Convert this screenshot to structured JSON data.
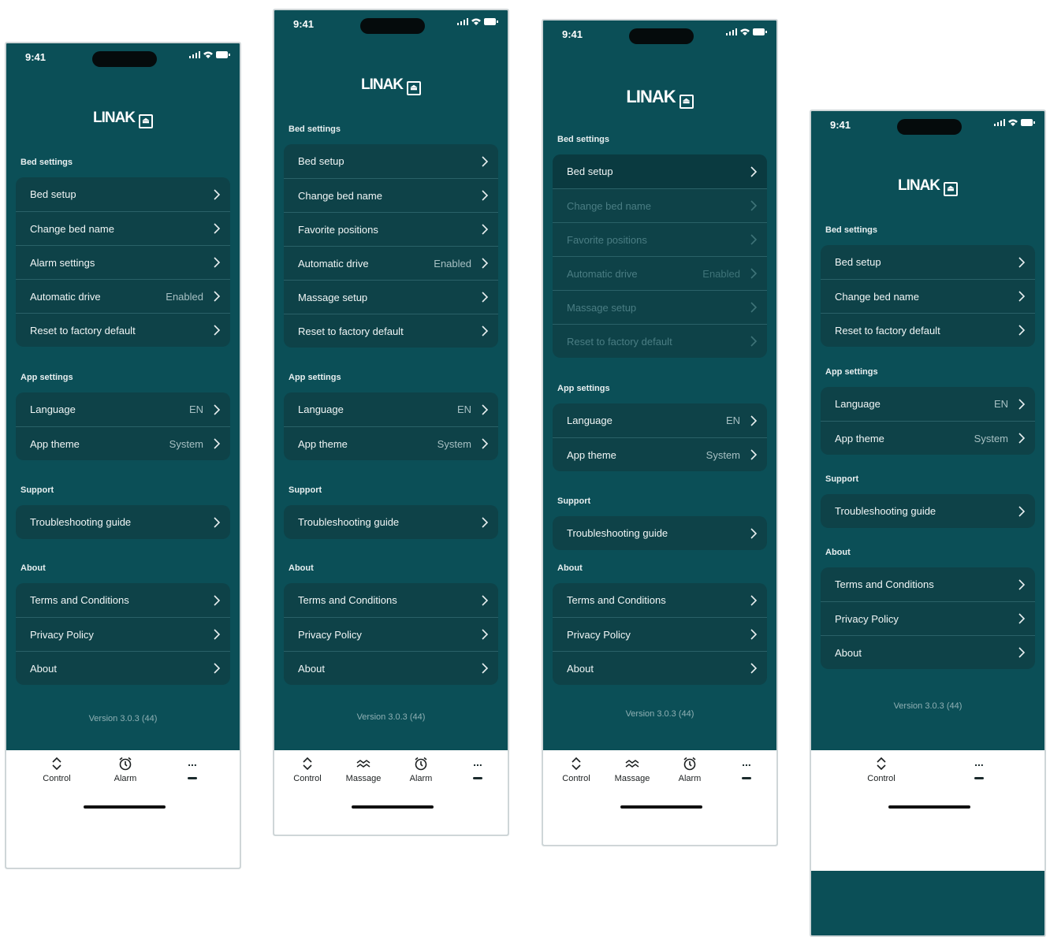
{
  "status": {
    "time": "9:41"
  },
  "brand": {
    "logo": "LINAK",
    "logo_icon": "linak-bed-icon"
  },
  "sections": {
    "bed": "Bed settings",
    "app": "App settings",
    "support": "Support",
    "about": "About"
  },
  "labels": {
    "bed_setup": "Bed setup",
    "change_bed_name": "Change bed name",
    "alarm_settings": "Alarm settings",
    "favorite_positions": "Favorite positions",
    "automatic_drive": "Automatic drive",
    "automatic_drive_value": "Enabled",
    "massage_setup": "Massage setup",
    "reset_factory": "Reset to factory default",
    "language": "Language",
    "language_value": "EN",
    "app_theme": "App theme",
    "app_theme_value": "System",
    "troubleshooting": "Troubleshooting guide",
    "terms": "Terms and Conditions",
    "privacy": "Privacy Policy",
    "about": "About",
    "version": "Version 3.0.3 (44)"
  },
  "tabs": {
    "control": "Control",
    "alarm": "Alarm",
    "massage": "Massage",
    "more": "..."
  },
  "colors": {
    "background": "#0b4f57",
    "card": "#0e4248",
    "tabbar": "#ffffff"
  }
}
